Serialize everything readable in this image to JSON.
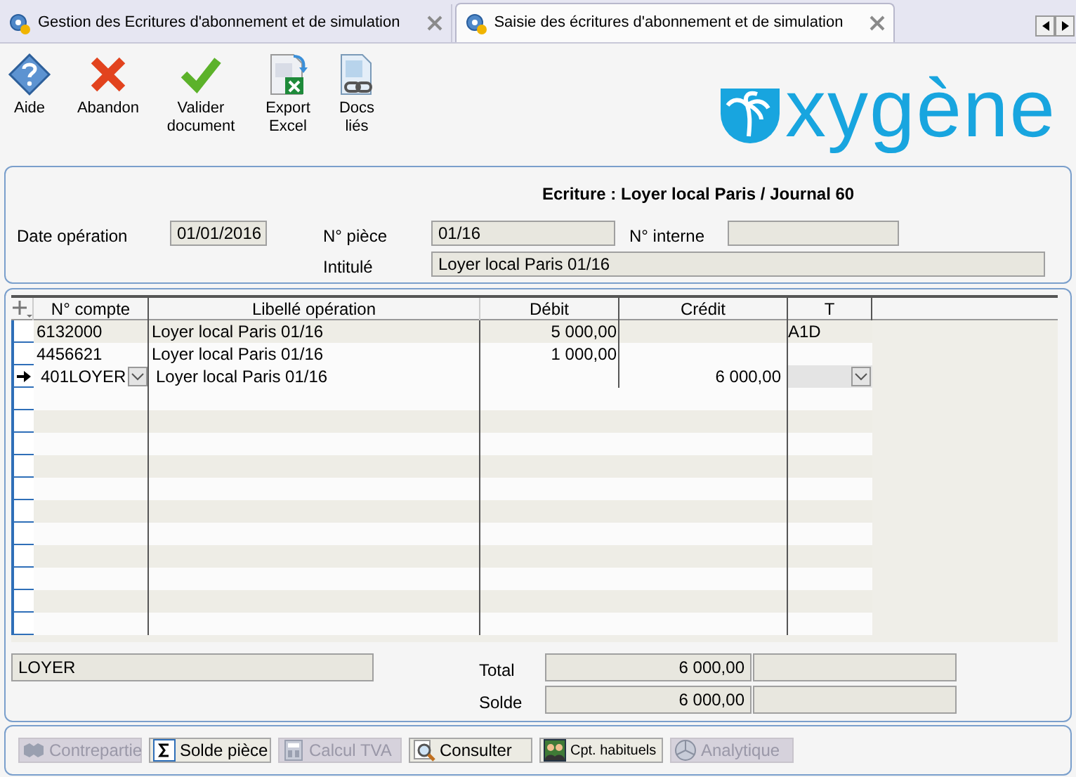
{
  "tabs": [
    {
      "label": "Gestion des Ecritures d'abonnement et de simulation",
      "selected": false
    },
    {
      "label": "Saisie des écritures d'abonnement et de simulation",
      "selected": true
    }
  ],
  "toolbar": [
    {
      "label": "Aide"
    },
    {
      "label": "Abandon"
    },
    {
      "label": "Valider\ndocument"
    },
    {
      "label": "Export\nExcel"
    },
    {
      "label": "Docs\nliés"
    }
  ],
  "logo": "xygène",
  "header": {
    "title": "Ecriture : Loyer local Paris / Journal 60",
    "date_label": "Date opération",
    "date": "01/01/2016",
    "piece_label": "N° pièce",
    "piece": "01/16",
    "interne_label": "N° interne",
    "intitule_label": "Intitulé",
    "intitule": "Loyer local Paris 01/16"
  },
  "grid": {
    "columns": [
      "N° compte",
      "Libellé opération",
      "Débit",
      "Crédit",
      "T"
    ],
    "rows": [
      {
        "compte": "6132000",
        "libelle": "Loyer local Paris 01/16",
        "debit": "5 000,00",
        "credit": "",
        "t": "A1D",
        "current": false
      },
      {
        "compte": "4456621",
        "libelle": "Loyer local Paris 01/16",
        "debit": "1 000,00",
        "credit": "",
        "t": "",
        "current": false
      },
      {
        "compte": "401LOYER",
        "libelle": "Loyer local Paris 01/16",
        "debit": "",
        "credit": "6 000,00",
        "t": "",
        "current": true
      }
    ]
  },
  "footer": {
    "account_name": "LOYER",
    "total_label": "Total",
    "total": "6 000,00",
    "solde_label": "Solde",
    "solde": "6 000,00"
  },
  "actions": [
    {
      "label": "Contrepartie",
      "disabled": true
    },
    {
      "label": "Solde pièce",
      "disabled": false
    },
    {
      "label": "Calcul TVA",
      "disabled": true
    },
    {
      "label": "Consulter",
      "disabled": false
    },
    {
      "label": "Cpt. habituels",
      "disabled": false
    },
    {
      "label": "Analytique",
      "disabled": true
    }
  ]
}
